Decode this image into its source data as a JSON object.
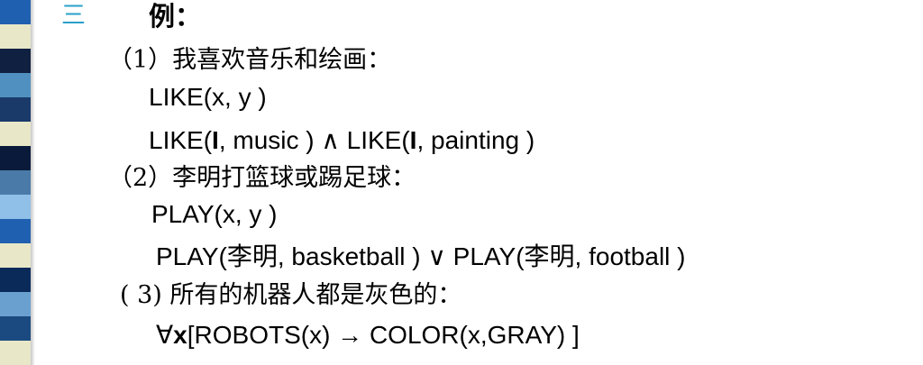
{
  "decor": {
    "stripe_colors": [
      "#2060b0",
      "#e8e8c8",
      "#102040",
      "#5090c0",
      "#1a3a6a",
      "#e8e8c8",
      "#0a1a3a",
      "#4a7aa8",
      "#90c0e8",
      "#2060b0",
      "#e8e8c8",
      "#0a2a5a",
      "#6aa0d0",
      "#1a4a80",
      "#e8e8c8"
    ]
  },
  "heading": {
    "number": "三",
    "title": "例："
  },
  "examples": [
    {
      "label": "（1）我喜欢音乐和绘画：",
      "predicate": "LIKE(x, y )",
      "formula": {
        "part1": "LIKE(",
        "arg1": "I",
        "part2": ", music ) ∧ LIKE(",
        "arg2": "I",
        "part3": ", painting )"
      }
    },
    {
      "label": "（2）李明打篮球或踢足球：",
      "predicate": "PLAY(x, y )",
      "formula": {
        "part1": "PLAY(",
        "arg1": "李明",
        "part2": ", basketball ) ∨ PLAY(",
        "arg2": "李明",
        "part3": ", football )"
      }
    },
    {
      "label": "( 3)  所有的机器人都是灰色的：",
      "formula": {
        "quantifier": "∀",
        "var": "x",
        "rest": "[ROBOTS(x) → COLOR(x,GRAY) ]"
      }
    }
  ]
}
